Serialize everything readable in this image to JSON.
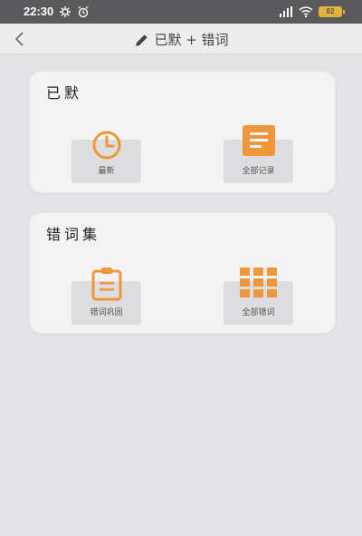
{
  "status_bar": {
    "time": "22:30",
    "battery": "82"
  },
  "nav": {
    "title": "已默 + 错词"
  },
  "cards": [
    {
      "title": "已默",
      "tiles": [
        {
          "label": "最新",
          "icon": "clock-icon"
        },
        {
          "label": "全部记录",
          "icon": "document-icon"
        }
      ]
    },
    {
      "title": "错词集",
      "tiles": [
        {
          "label": "错词巩固",
          "icon": "clipboard-icon"
        },
        {
          "label": "全部错词",
          "icon": "grid-icon"
        }
      ]
    }
  ],
  "colors": {
    "accent": "#f0963a",
    "background": "#e4e4e6",
    "card": "#f3f3f4",
    "tile": "#dddddf"
  }
}
